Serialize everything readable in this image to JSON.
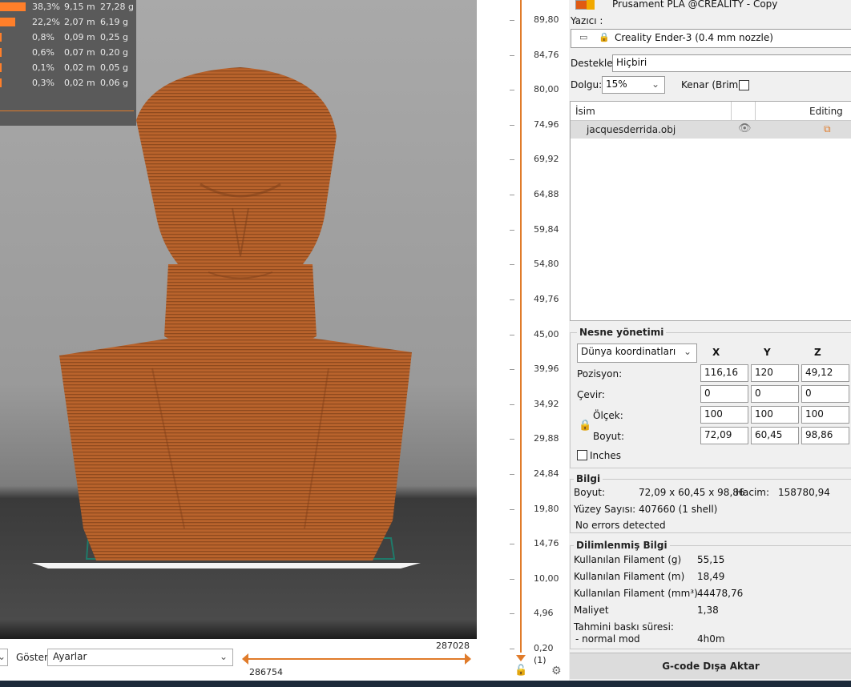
{
  "filament_stats": [
    {
      "fill": 1.0,
      "percent": "38,3%",
      "length": "9,15 m",
      "weight": "27,28 g"
    },
    {
      "fill": 0.58,
      "percent": "22,2%",
      "length": "2,07 m",
      "weight": "6,19 g"
    },
    {
      "fill": 0.02,
      "percent": "0,8%",
      "length": "0,09 m",
      "weight": "0,25 g"
    },
    {
      "fill": 0.016,
      "percent": "0,6%",
      "length": "0,07 m",
      "weight": "0,20 g"
    },
    {
      "fill": 0.01,
      "percent": "0,1%",
      "length": "0,02 m",
      "weight": "0,05 g"
    },
    {
      "fill": 0.01,
      "percent": "0,3%",
      "length": "0,02 m",
      "weight": "0,06 g"
    }
  ],
  "bottom": {
    "show_label": "Göster",
    "show_value": "Ayarlar",
    "h_slider_top_value": "287028",
    "h_slider_bottom_value": "286754"
  },
  "vslider": {
    "ticks": [
      "89,80",
      "84,76",
      "80,00",
      "74,96",
      "69,92",
      "64,88",
      "59,84",
      "54,80",
      "49,76",
      "45,00",
      "39,96",
      "34,92",
      "29,88",
      "24,84",
      "19,80",
      "14,76",
      "10,00",
      "4,96",
      "0,20"
    ],
    "bottom_label": "(1)",
    "color": "#e07b2a"
  },
  "filament_name": "Prusament PLA @CREALITY - Copy",
  "printer": {
    "label": "Yazıcı :",
    "value": "Creality Ender-3 (0.4 mm nozzle)"
  },
  "supports": {
    "label": "Destekler:",
    "value": "Hiçbiri"
  },
  "infill": {
    "label": "Dolgu:",
    "value": "15%",
    "brim_label": "Kenar (Brim):"
  },
  "object_list": {
    "col_name": "İsim",
    "col_editing": "Editing",
    "items": [
      {
        "name": "jacquesderrida.obj"
      }
    ]
  },
  "object_manip": {
    "title": "Nesne yönetimi",
    "coord_mode": "Dünya koordinatları",
    "axes": [
      "X",
      "Y",
      "Z"
    ],
    "rows": [
      {
        "label": "Pozisyon:",
        "values": [
          "116,16",
          "120",
          "49,12"
        ]
      },
      {
        "label": "Çevir:",
        "values": [
          "0",
          "0",
          "0"
        ]
      },
      {
        "label": "Ölçek:",
        "values": [
          "100",
          "100",
          "100"
        ]
      },
      {
        "label": "Boyut:",
        "values": [
          "72,09",
          "60,45",
          "98,86"
        ]
      }
    ],
    "inches_label": "Inches"
  },
  "info": {
    "title": "Bilgi",
    "size_label": "Boyut:",
    "size_value": "72,09 x 60,45 x 98,86",
    "volume_label": "Hacim:",
    "volume_value": "158780,94",
    "facets_label": "Yüzey Sayısı:",
    "facets_value": "407660 (1 shell)",
    "errors": "No errors detected"
  },
  "sliced_info": {
    "title": "Dilimlenmiş Bilgi",
    "rows": [
      {
        "label": "Kullanılan Filament (g)",
        "value": "55,15"
      },
      {
        "label": "Kullanılan Filament (m)",
        "value": "18,49"
      },
      {
        "label": "Kullanılan Filament (mm³)",
        "value": "44478,76"
      },
      {
        "label": "Maliyet",
        "value": "1,38"
      }
    ],
    "time_label": "Tahmini baskı süresi:",
    "mode_label": "- normal mod",
    "mode_value": "4h0m"
  },
  "export_button": "G-code Dışa Aktar",
  "colors": {
    "model": "#b8612a",
    "accent": "#e07b2a",
    "bed_outline": "#1f7a6a"
  }
}
